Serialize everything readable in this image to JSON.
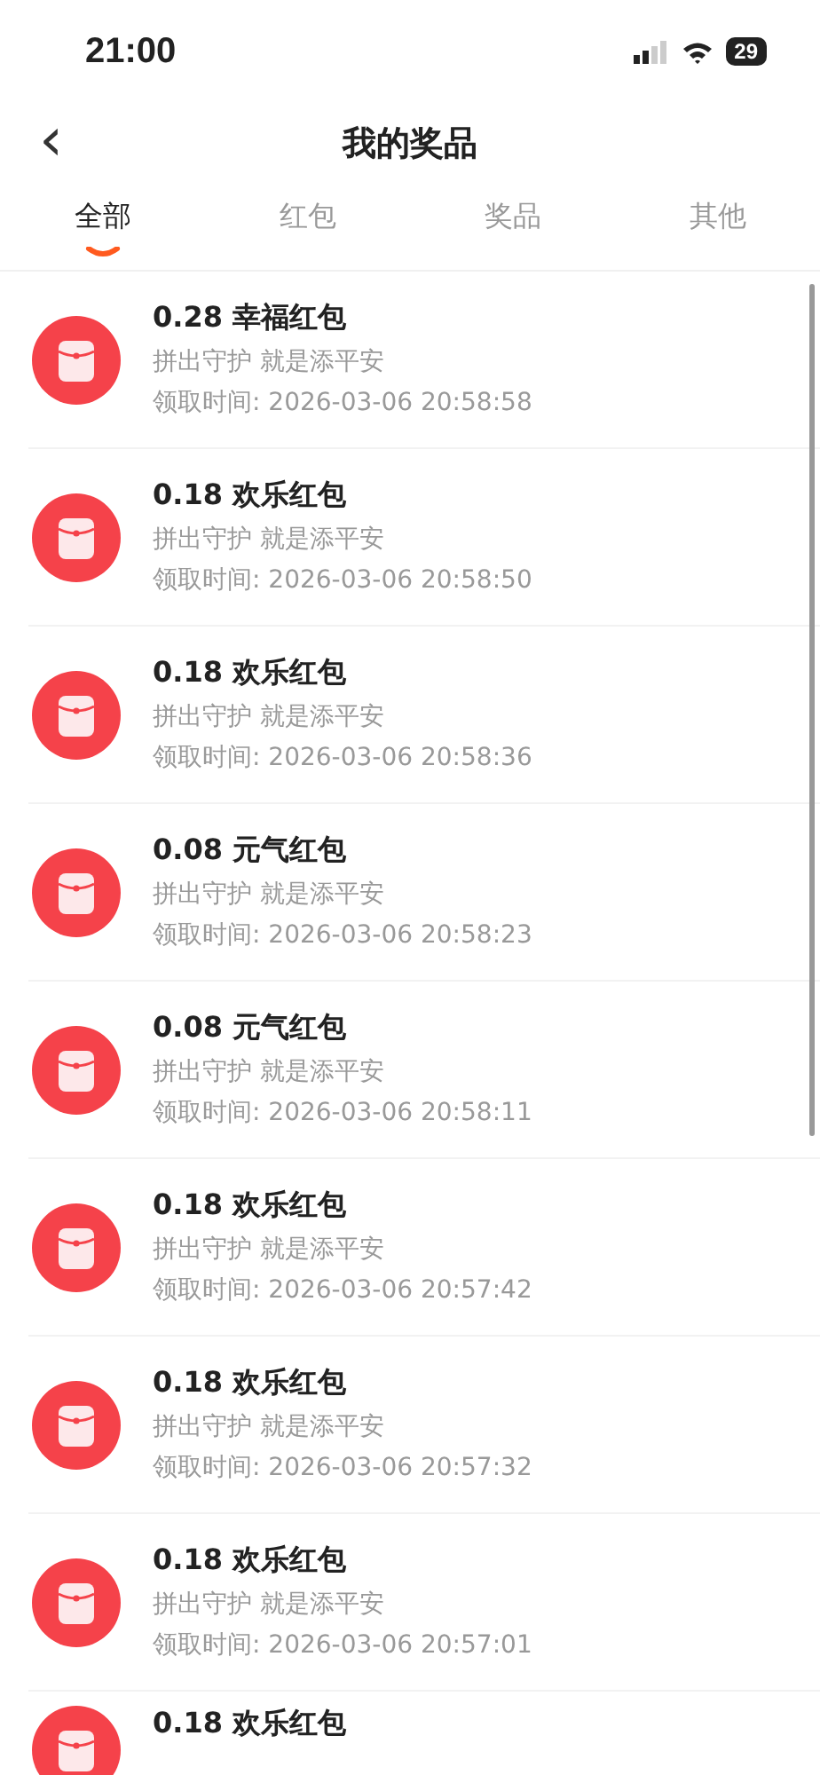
{
  "status_bar": {
    "time": "21:00",
    "battery": "29"
  },
  "nav": {
    "back": "‹",
    "title": "我的奖品"
  },
  "tabs": [
    {
      "label": "全部",
      "selected": true
    },
    {
      "label": "红包",
      "selected": false
    },
    {
      "label": "奖品",
      "selected": false
    },
    {
      "label": "其他",
      "selected": false
    }
  ],
  "prizes": [
    {
      "title": "0.28 幸福红包",
      "subtitle": "拼出守护 就是添平安",
      "time": "领取时间: 2026-03-06 20:58:58"
    },
    {
      "title": "0.18 欢乐红包",
      "subtitle": "拼出守护 就是添平安",
      "time": "领取时间: 2026-03-06 20:58:50"
    },
    {
      "title": "0.18 欢乐红包",
      "subtitle": "拼出守护 就是添平安",
      "time": "领取时间: 2026-03-06 20:58:36"
    },
    {
      "title": "0.08 元气红包",
      "subtitle": "拼出守护 就是添平安",
      "time": "领取时间: 2026-03-06 20:58:23"
    },
    {
      "title": "0.08 元气红包",
      "subtitle": "拼出守护 就是添平安",
      "time": "领取时间: 2026-03-06 20:58:11"
    },
    {
      "title": "0.18 欢乐红包",
      "subtitle": "拼出守护 就是添平安",
      "time": "领取时间: 2026-03-06 20:57:42"
    },
    {
      "title": "0.18 欢乐红包",
      "subtitle": "拼出守护 就是添平安",
      "time": "领取时间: 2026-03-06 20:57:32"
    },
    {
      "title": "0.18 欢乐红包",
      "subtitle": "拼出守护 就是添平安",
      "time": "领取时间: 2026-03-06 20:57:01"
    },
    {
      "title": "0.18 欢乐红包"
    }
  ]
}
